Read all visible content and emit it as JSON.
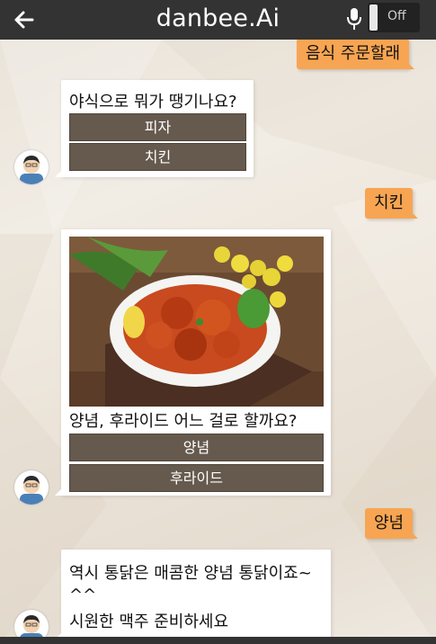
{
  "header": {
    "title": "danbee.Ai",
    "toggle_label": "Off"
  },
  "messages": {
    "user1": "음식 주문할래",
    "bot1_text": "야식으로 뭐가 땡기나요?",
    "bot1_choices": [
      "피자",
      "치킨"
    ],
    "user2": "치킨",
    "bot2_text": "양념, 후라이드 어느 걸로 할까요?",
    "bot2_choices": [
      "양념",
      "후라이드"
    ],
    "user3": "양념",
    "bot3_lines": [
      "역시 통닭은 매콤한 양념 통닭이죠~",
      "^^",
      "시원한 맥주 준비하세요"
    ]
  },
  "colors": {
    "header_bg": "#333333",
    "user_bubble": "#f7a552",
    "choice_button": "#665a4e"
  },
  "icons": [
    "back-arrow-icon",
    "microphone-icon",
    "bot-avatar",
    "fried-chicken-photo"
  ]
}
